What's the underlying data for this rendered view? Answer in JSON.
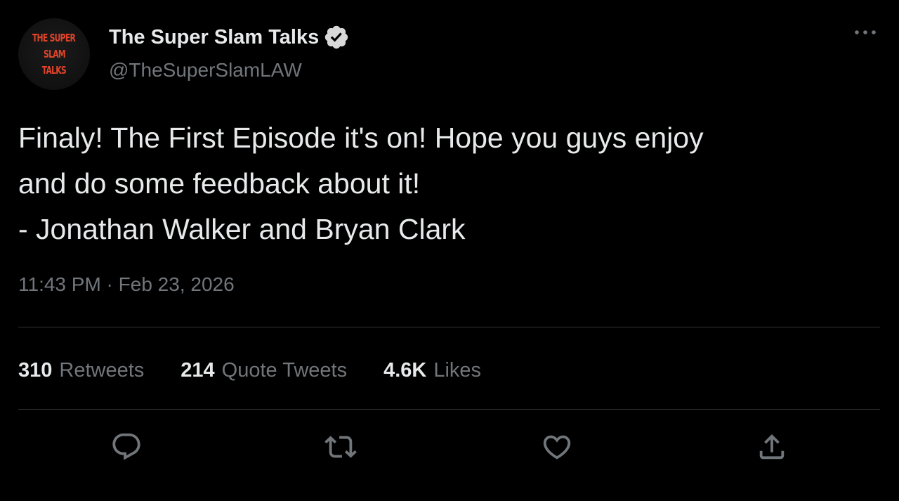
{
  "profile": {
    "avatar_lines": [
      "THE SUPER",
      "SLAM",
      "TALKS"
    ],
    "display_name": "The Super Slam Talks",
    "handle": "@TheSuperSlamLAW",
    "verified_icon": "verified-badge-icon"
  },
  "menu": {
    "icon": "more-horizontal-icon"
  },
  "tweet": {
    "lines": [
      "Finaly! The First Episode it's on! Hope you guys enjoy",
      "and do some feedback about it!",
      "- Jonathan Walker and Bryan Clark"
    ],
    "timestamp": "11:43 PM · Feb 23, 2026"
  },
  "stats": {
    "retweets": {
      "count": "310",
      "label": "Retweets"
    },
    "quotes": {
      "count": "214",
      "label": "Quote Tweets"
    },
    "likes": {
      "count": "4.6K",
      "label": "Likes"
    }
  },
  "actions": [
    {
      "name": "reply",
      "icon": "reply-icon"
    },
    {
      "name": "retweet",
      "icon": "retweet-icon"
    },
    {
      "name": "like",
      "icon": "heart-icon"
    },
    {
      "name": "share",
      "icon": "share-icon"
    }
  ],
  "colors": {
    "background": "#000000",
    "primary_text": "#e7e9ea",
    "secondary_text": "#71767b",
    "divider": "#2f3336",
    "avatar_text": "#e0442a",
    "verified_badge": "#d9d9d9"
  }
}
